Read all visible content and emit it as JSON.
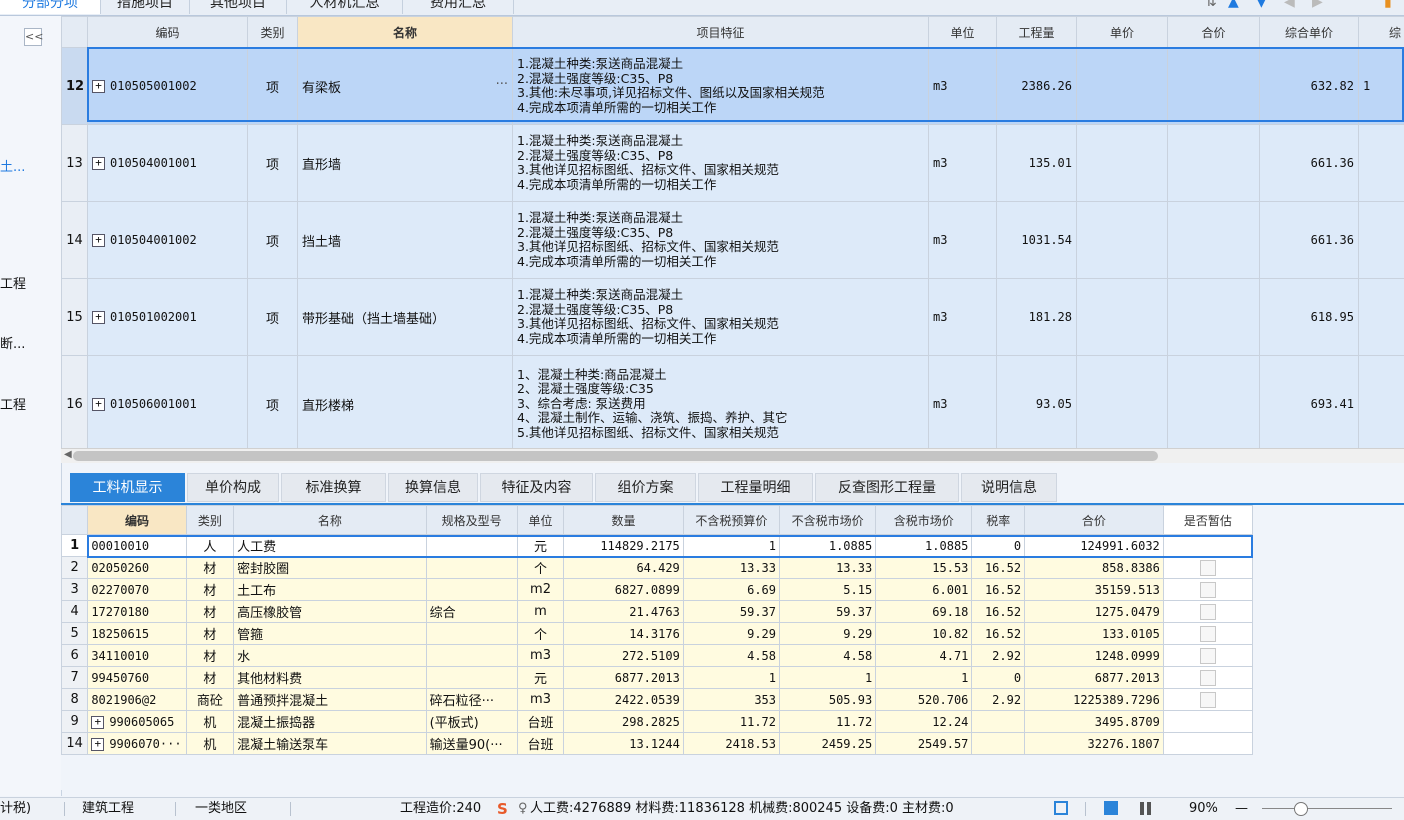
{
  "top_tabs": [
    {
      "label": "分部分项",
      "active": true
    },
    {
      "label": "措施项目"
    },
    {
      "label": "其他项目"
    },
    {
      "label": "人材机汇总"
    },
    {
      "label": "费用汇总"
    }
  ],
  "sidebar": {
    "collapse_label": "<<",
    "items": [
      "土...",
      "工程",
      "断...",
      "工程"
    ]
  },
  "upper_grid": {
    "headers": [
      "编码",
      "类别",
      "名称",
      "项目特征",
      "单位",
      "工程量",
      "单价",
      "合价",
      "综合单价",
      "综"
    ],
    "rows": [
      {
        "num": "12",
        "code": "010505001002",
        "type": "项",
        "name": "有梁板",
        "name_more": "···",
        "features": [
          "1.混凝土种类:泵送商品混凝土",
          "2.混凝土强度等级:C35、P8",
          "3.其他:未尽事项,详见招标文件、图纸以及国家相关规范",
          "4.完成本项清单所需的一切相关工作"
        ],
        "unit": "m3",
        "qty": "2386.26",
        "price": "",
        "total": "",
        "comp_price": "632.82",
        "comp_total": "1"
      },
      {
        "num": "13",
        "code": "010504001001",
        "type": "项",
        "name": "直形墙",
        "features": [
          "1.混凝土种类:泵送商品混凝土",
          "2.混凝土强度等级:C35、P8",
          "3.其他详见招标图纸、招标文件、国家相关规范",
          "4.完成本项清单所需的一切相关工作"
        ],
        "unit": "m3",
        "qty": "135.01",
        "price": "",
        "total": "",
        "comp_price": "661.36",
        "comp_total": ""
      },
      {
        "num": "14",
        "code": "010504001002",
        "type": "项",
        "name": "挡土墙",
        "features": [
          "1.混凝土种类:泵送商品混凝土",
          "2.混凝土强度等级:C35、P8",
          "3.其他详见招标图纸、招标文件、国家相关规范",
          "4.完成本项清单所需的一切相关工作"
        ],
        "unit": "m3",
        "qty": "1031.54",
        "price": "",
        "total": "",
        "comp_price": "661.36",
        "comp_total": ""
      },
      {
        "num": "15",
        "code": "010501002001",
        "type": "项",
        "name": "带形基础（挡土墙基础）",
        "features": [
          "1.混凝土种类:泵送商品混凝土",
          "2.混凝土强度等级:C35、P8",
          "3.其他详见招标图纸、招标文件、国家相关规范",
          "4.完成本项清单所需的一切相关工作"
        ],
        "unit": "m3",
        "qty": "181.28",
        "price": "",
        "total": "",
        "comp_price": "618.95",
        "comp_total": ""
      },
      {
        "num": "16",
        "code": "010506001001",
        "type": "项",
        "name": "直形楼梯",
        "features": [
          "1、混凝土种类:商品混凝土",
          "2、混凝土强度等级:C35",
          "3、综合考虑: 泵送费用",
          "4、混凝土制作、运输、浇筑、振捣、养护、其它",
          "5.其他详见招标图纸、招标文件、国家相关规范"
        ],
        "unit": "m3",
        "qty": "93.05",
        "price": "",
        "total": "",
        "comp_price": "693.41",
        "comp_total": ""
      }
    ]
  },
  "lower_tabs": [
    "工料机显示",
    "单价构成",
    "标准换算",
    "换算信息",
    "特征及内容",
    "组价方案",
    "工程量明细",
    "反查图形工程量",
    "说明信息"
  ],
  "lower_grid": {
    "headers": [
      "编码",
      "类别",
      "名称",
      "规格及型号",
      "单位",
      "数量",
      "不含税预算价",
      "不含税市场价",
      "含税市场价",
      "税率",
      "合价",
      "是否暂估"
    ],
    "rows": [
      {
        "num": "1",
        "code": "00010010",
        "type": "人",
        "name": "人工费",
        "spec": "",
        "unit": "元",
        "qty": "114829.2175",
        "budget": "1",
        "market": "1.0885",
        "market_tax": "1.0885",
        "tax": "0",
        "total": "124991.6032",
        "has_check": false
      },
      {
        "num": "2",
        "code": "02050260",
        "type": "材",
        "name": "密封胶圈",
        "spec": "",
        "unit": "个",
        "qty": "64.429",
        "budget": "13.33",
        "market": "13.33",
        "market_tax": "15.53",
        "tax": "16.52",
        "total": "858.8386",
        "has_check": true
      },
      {
        "num": "3",
        "code": "02270070",
        "type": "材",
        "name": "土工布",
        "spec": "",
        "unit": "m2",
        "qty": "6827.0899",
        "budget": "6.69",
        "market": "5.15",
        "market_tax": "6.001",
        "tax": "16.52",
        "total": "35159.513",
        "has_check": true
      },
      {
        "num": "4",
        "code": "17270180",
        "type": "材",
        "name": "高压橡胶管",
        "spec": "综合",
        "unit": "m",
        "qty": "21.4763",
        "budget": "59.37",
        "market": "59.37",
        "market_tax": "69.18",
        "tax": "16.52",
        "total": "1275.0479",
        "has_check": true
      },
      {
        "num": "5",
        "code": "18250615",
        "type": "材",
        "name": "管箍",
        "spec": "",
        "unit": "个",
        "qty": "14.3176",
        "budget": "9.29",
        "market": "9.29",
        "market_tax": "10.82",
        "tax": "16.52",
        "total": "133.0105",
        "has_check": true
      },
      {
        "num": "6",
        "code": "34110010",
        "type": "材",
        "name": "水",
        "spec": "",
        "unit": "m3",
        "qty": "272.5109",
        "budget": "4.58",
        "market": "4.58",
        "market_tax": "4.71",
        "tax": "2.92",
        "total": "1248.0999",
        "has_check": true
      },
      {
        "num": "7",
        "code": "99450760",
        "type": "材",
        "name": "其他材料费",
        "spec": "",
        "unit": "元",
        "qty": "6877.2013",
        "budget": "1",
        "market": "1",
        "market_tax": "1",
        "tax": "0",
        "total": "6877.2013",
        "has_check": true
      },
      {
        "num": "8",
        "code": "8021906@2",
        "type": "商砼",
        "name": "普通预拌混凝土",
        "spec": "碎石粒径···",
        "unit": "m3",
        "qty": "2422.0539",
        "budget": "353",
        "market": "505.93",
        "market_tax": "520.706",
        "tax": "2.92",
        "total": "1225389.7296",
        "has_check": true
      },
      {
        "num": "9",
        "code": "990605065",
        "expand": true,
        "type": "机",
        "name": "混凝土振捣器",
        "spec": "(平板式)",
        "unit": "台班",
        "qty": "298.2825",
        "budget": "11.72",
        "market": "11.72",
        "market_tax": "12.24",
        "tax": "",
        "total": "3495.8709",
        "has_check": false
      },
      {
        "num": "14",
        "code": "9906070···",
        "expand": true,
        "type": "机",
        "name": "混凝土输送泵车",
        "spec": "输送量90(···",
        "unit": "台班",
        "qty": "13.1244",
        "budget": "2418.53",
        "market": "2459.25",
        "market_tax": "2549.57",
        "tax": "",
        "total": "32276.1807",
        "has_check": false
      }
    ]
  },
  "status_bar": {
    "items": [
      "计税)",
      "建筑工程",
      "一类地区"
    ],
    "cost": "工程造价:240",
    "breakdown": "人工费:4276889  材料费:11836128  机械费:800245  设备费:0  主材费:0",
    "zoom": "90%",
    "zoom_minus": "—"
  },
  "colors": {
    "accent": "#2b84d9",
    "selection": "#2a7ce0",
    "row_bg": "#ddeaf9",
    "lower_row_bg": "#fffbe0"
  }
}
